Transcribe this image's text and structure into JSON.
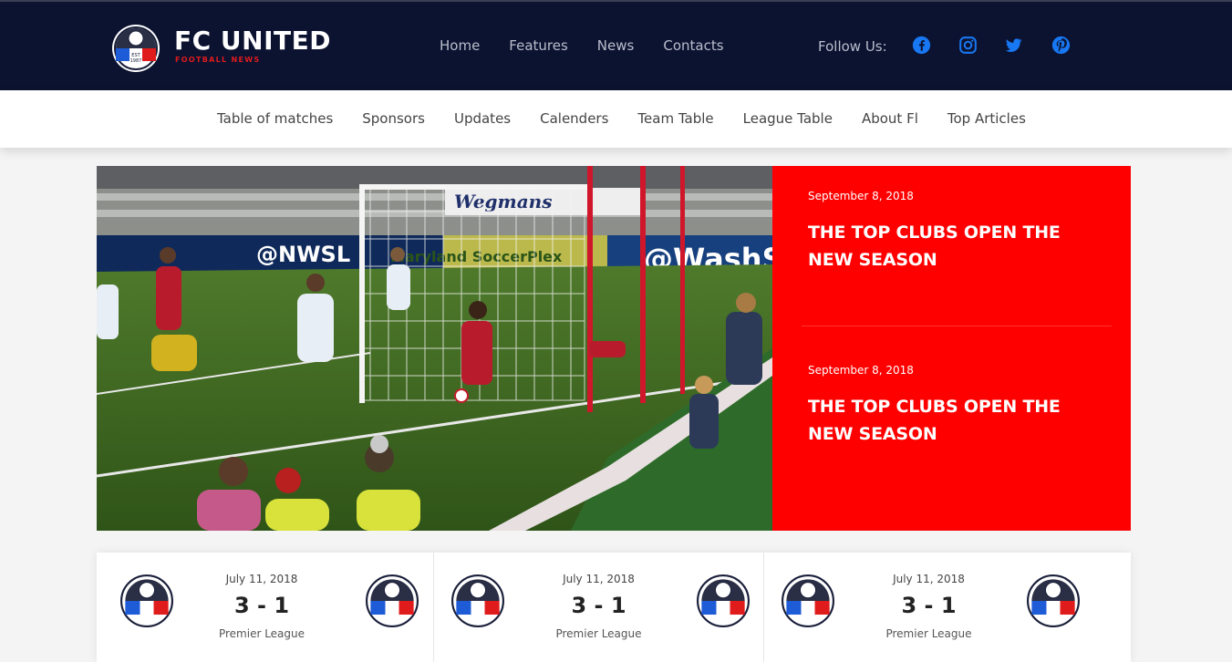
{
  "header": {
    "brand": "FC UNITED",
    "brand_sub": "FOOTBALL NEWS",
    "nav": [
      "Home",
      "Features",
      "News",
      "Contacts"
    ],
    "follow_label": "Follow Us:",
    "social_icons": [
      "facebook-icon",
      "instagram-icon",
      "twitter-icon",
      "pinterest-icon"
    ],
    "social_color": "#1877f2",
    "badge_text": "EST 1987"
  },
  "subnav": [
    "Table of matches",
    "Sponsors",
    "Updates",
    "Calenders",
    "Team Table",
    "League Table",
    "About Fl",
    "Top Articles"
  ],
  "hero": {
    "image_texts": [
      "@NWSL",
      "@WashS",
      "Wegmans",
      "Maryland SoccerPlex"
    ],
    "stories": [
      {
        "date": "September 8, 2018",
        "title": "THE TOP CLUBS OPEN THE NEW SEASON"
      },
      {
        "date": "September 8, 2018",
        "title": "THE TOP CLUBS OPEN THE NEW SEASON"
      }
    ],
    "accent": "#ff0000"
  },
  "matches": [
    {
      "date": "July 11, 2018",
      "score": "3 - 1",
      "league": "Premier League"
    },
    {
      "date": "July 11, 2018",
      "score": "3 - 1",
      "league": "Premier League"
    },
    {
      "date": "July 11, 2018",
      "score": "3 - 1",
      "league": "Premier League"
    }
  ]
}
